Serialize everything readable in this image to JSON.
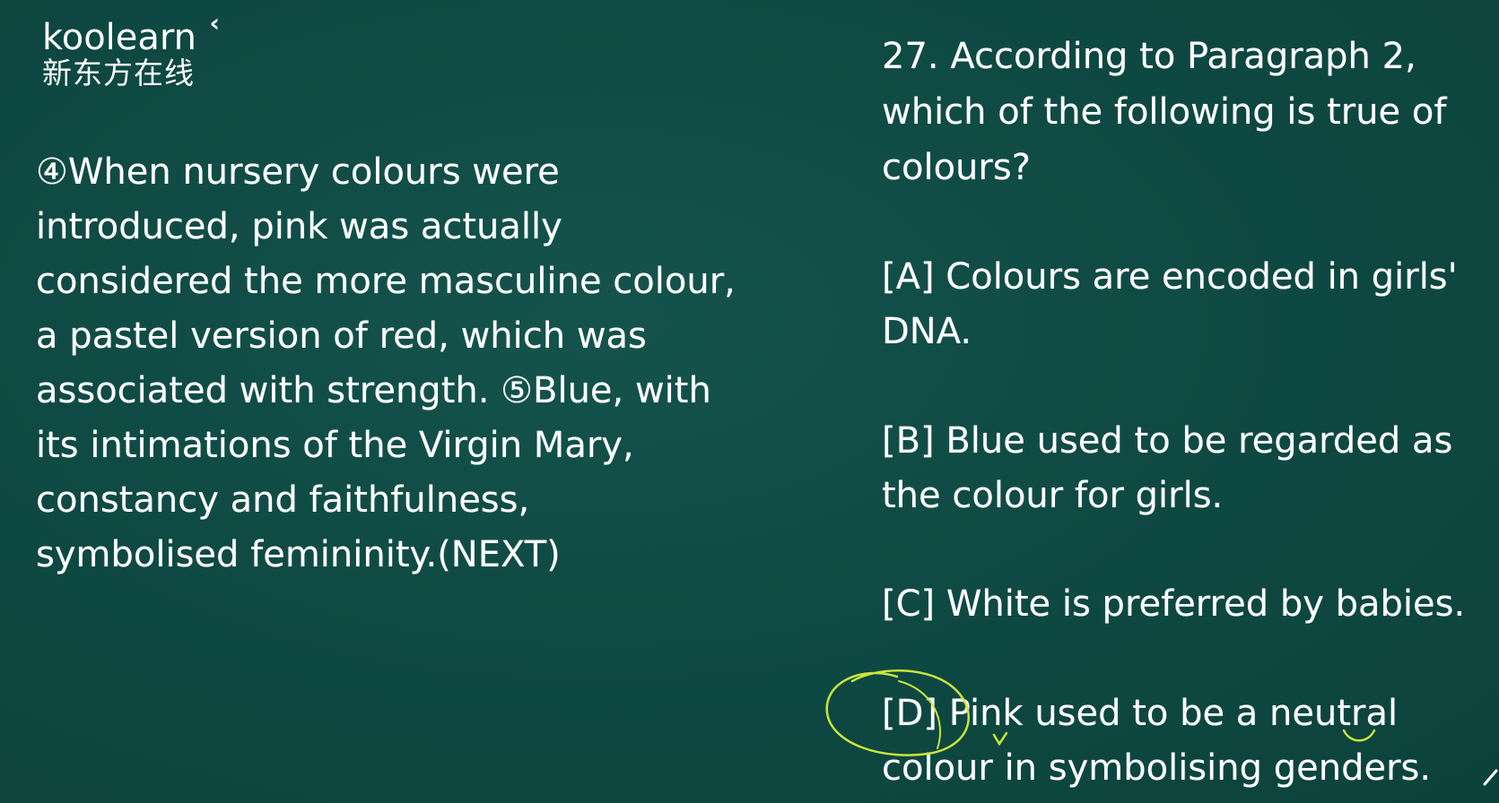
{
  "logo": {
    "brand": "koolearn",
    "chinese_name": "新东方在线"
  },
  "passage": {
    "lines": [
      "④When nursery colours were",
      "introduced, pink was actually",
      "considered the more masculine colour,",
      "a pastel version of red, which was",
      "associated with strength. ⑤Blue, with",
      "its intimations of the Virgin Mary,",
      "constancy and faithfulness,",
      "symbolised femininity.(NEXT)"
    ]
  },
  "question": {
    "lines": [
      "27. According to Paragraph 2,",
      "which of the following is true of",
      "colours?"
    ]
  },
  "options": [
    {
      "lines": [
        "[A] Colours are encoded in girls'",
        "DNA."
      ]
    },
    {
      "lines": [
        "[B] Blue used to be regarded as",
        "the colour for girls."
      ]
    },
    {
      "lines": [
        "[C] White is preferred by babies."
      ]
    },
    {
      "lines": [
        "[D] Pink used to be a neutral",
        "colour in symbolising genders."
      ]
    }
  ],
  "colors": {
    "background": "#0f4a44",
    "text": "#ffffff",
    "annotation": "#c8e63a"
  }
}
